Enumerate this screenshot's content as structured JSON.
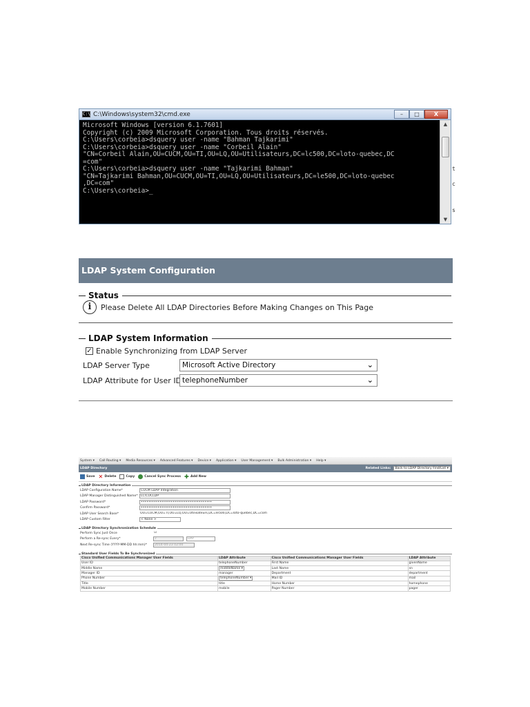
{
  "cmd": {
    "title": "C:\\Windows\\system32\\cmd.exe",
    "icon_label": "C:\\",
    "buttons": {
      "minimize": "–",
      "maximize": "□",
      "close": "X"
    },
    "lines": [
      "Microsoft Windows [version 6.1.7601]",
      "Copyright (c) 2009 Microsoft Corporation. Tous droits réservés.",
      "",
      "C:\\Users\\corbeia>dsquery user -name \"Bahman Tajkarimi\"",
      "",
      "C:\\Users\\corbeia>dsquery user -name \"Corbeil Alain\"",
      "\"CN=Corbeil Alain,OU=CUCM,OU=TI,OU=LQ,OU=Utilisateurs,DC=lc500,DC=loto-quebec,DC",
      "=com\"",
      "",
      "C:\\Users\\corbeia>dsquery user -name \"Tajkarimi Bahman\"",
      "\"CN=Tajkarimi Bahman,OU=CUCM,OU=TI,OU=LQ,OU=Utilisateurs,DC=le500,DC=loto-quebec",
      ",DC=com\"",
      "",
      "C:\\Users\\corbeia>_"
    ],
    "edge_chars": [
      "t",
      "c",
      "s"
    ]
  },
  "ldap_system": {
    "header": "LDAP System Configuration",
    "status_legend": "Status",
    "status_message": "Please Delete All LDAP Directories Before Making Changes on This Page",
    "info_legend": "LDAP System Information",
    "enable_sync_label": "Enable Synchronizing from LDAP Server",
    "enable_sync_mark": "✓",
    "server_type_label": "LDAP Server Type",
    "server_type_value": "Microsoft Active Directory",
    "user_id_attr_label": "LDAP Attribute for User ID",
    "user_id_attr_value": "telephoneNumber"
  },
  "ldap_directory": {
    "menu": [
      "System ▾",
      "Call Routing ▾",
      "Media Resources ▾",
      "Advanced Features ▾",
      "Device ▾",
      "Application ▾",
      "User Management ▾",
      "Bulk Administration ▾",
      "Help ▾"
    ],
    "title": "LDAP Directory",
    "related_links_label": "Related Links:",
    "related_links_value": "Back to LDAP Directory Find/List ▾",
    "toolbar": {
      "save": "Save",
      "delete": "Delete",
      "copy": "Copy",
      "cancel_sync": "Cancel Sync Process",
      "add_new": "Add New"
    },
    "info_legend": "LDAP Directory Information",
    "fields": [
      {
        "label": "LDAP Configuration Name*",
        "value": "CUCM LDAP Integration"
      },
      {
        "label": "LDAP Manager Distinguished Name*",
        "value": "LC\\CUCLDP"
      },
      {
        "label": "LDAP Password*",
        "value": "••••••••••••••••••••••••••••••••••••••"
      },
      {
        "label": "Confirm Password*",
        "value": "••••••••••••••••••••••••••••••••••••••"
      },
      {
        "label": "LDAP User Search Base*",
        "value": "OU=CUCM,OU=TI,OU=LQ,OU=Utilisateurs,DC=le500,DC=loto-quebec,DC=com"
      },
      {
        "label": "LDAP Custom Filter",
        "value": "< None >"
      }
    ],
    "sync_legend": "LDAP Directory Synchronization Schedule",
    "sync_fields": [
      {
        "label": "Perform Sync Just Once",
        "value": "☑"
      },
      {
        "label": "Perform a Re-sync Every*",
        "value": "7",
        "unit": "DAY"
      },
      {
        "label": "Next Re-sync Time (YYYY-MM-DD hh:mm)*",
        "value": "2014-04-23 02:00"
      }
    ],
    "std_legend": "Standard User Fields To Be Synchronized",
    "table_headers": [
      "Cisco Unified Communications Manager User Fields",
      "LDAP Attribute",
      "Cisco Unified Communications Manager User Fields",
      "LDAP Attribute"
    ],
    "table_rows": [
      [
        "User ID",
        "telephoneNumber",
        "First Name",
        "givenName"
      ],
      [
        "Middle Name",
        "middleName ▾",
        "Last Name",
        "sn"
      ],
      [
        "Manager ID",
        "manager",
        "Department",
        "department"
      ],
      [
        "Phone Number",
        "telephoneNumber ▾",
        "Mail ID",
        "mail"
      ],
      [
        "Title",
        "title",
        "Home Number",
        "homephone"
      ],
      [
        "Mobile Number",
        "mobile",
        "Pager Number",
        "pager"
      ]
    ]
  }
}
